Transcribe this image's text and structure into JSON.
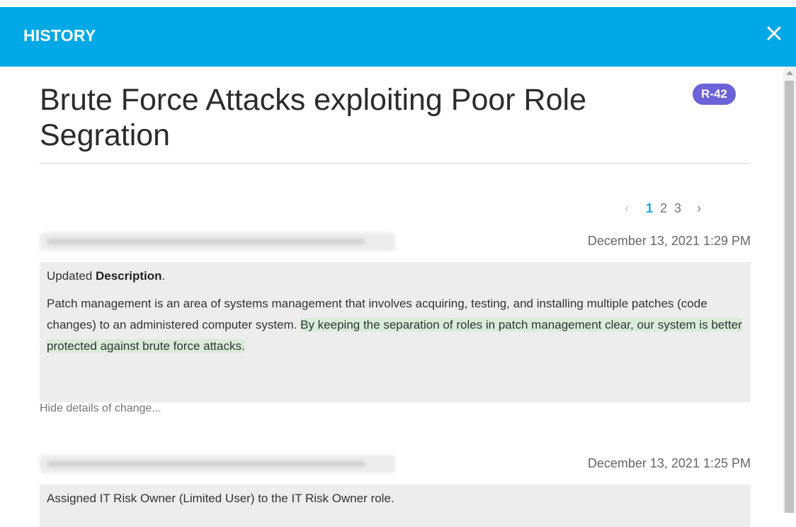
{
  "header": {
    "title": "HISTORY",
    "close_icon": "close-icon"
  },
  "record": {
    "title": "Brute Force Attacks exploiting Poor Role Segration",
    "badge": "R-42"
  },
  "pagination": {
    "prev": "‹",
    "pages": [
      "1",
      "2",
      "3"
    ],
    "active_page": "1",
    "next": "›"
  },
  "entries": [
    {
      "timestamp": "December 13, 2021 1:29 PM",
      "action_prefix": "Updated ",
      "action_field": "Description",
      "action_suffix": ".",
      "description_plain": "Patch management is an area of systems management that involves acquiring, testing, and installing multiple patches (code changes) to an administered computer system. ",
      "description_added": "By keeping the separation of roles in patch management clear, our system is better protected against brute force attacks.",
      "toggle_label": "Hide details of change..."
    },
    {
      "timestamp": "December 13, 2021 1:25 PM",
      "action_text": "Assigned IT Risk Owner (Limited User) to the IT Risk Owner role."
    }
  ],
  "colors": {
    "header": "#00a8e6",
    "badge": "#6c63d9",
    "active_page": "#1aa3e0",
    "added_highlight": "#d8ecd9"
  }
}
